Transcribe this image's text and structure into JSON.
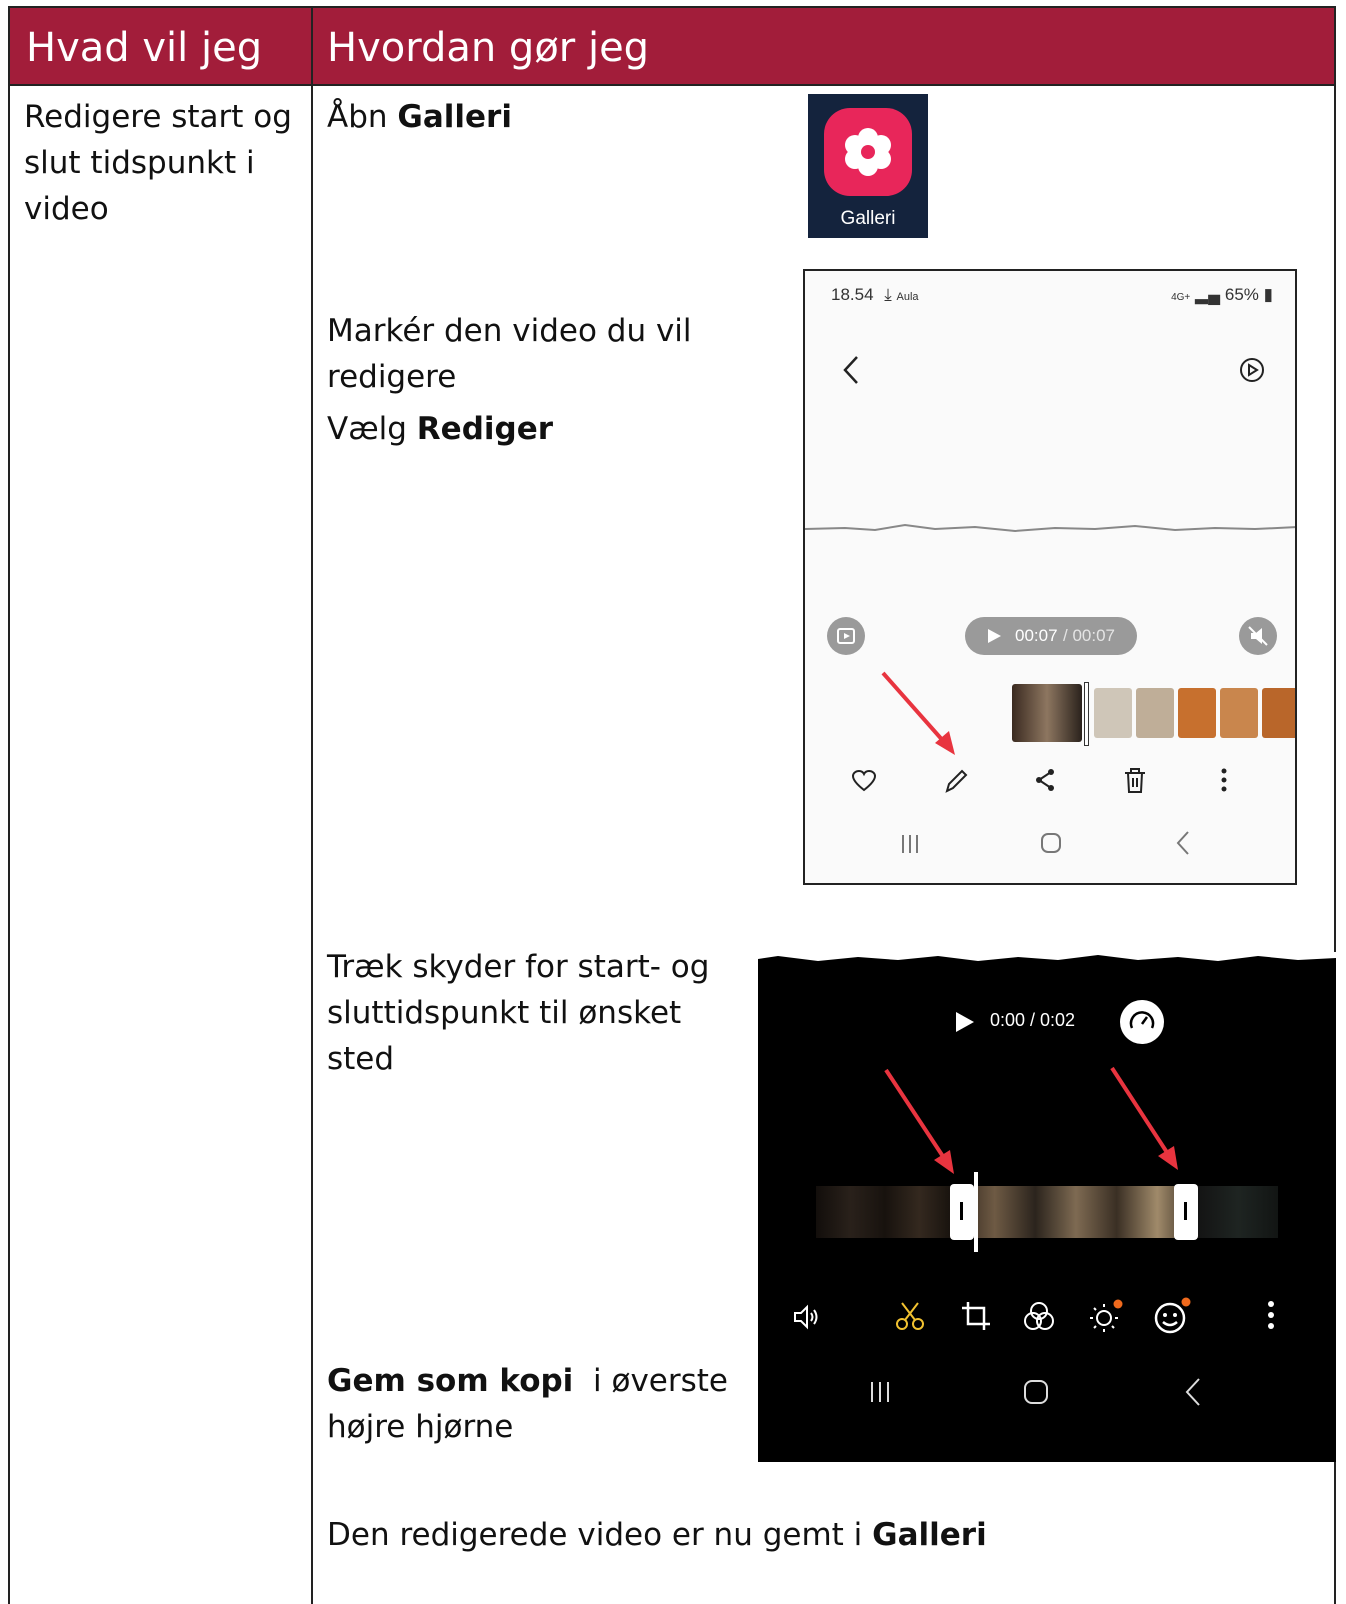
{
  "header": {
    "col1": "Hvad vil jeg",
    "col2": "Hvordan gør jeg"
  },
  "task": {
    "line1": "Redigere start og",
    "line2": "slut tidspunkt i",
    "line3": "video"
  },
  "steps": {
    "s1_prefix": "Åbn ",
    "s1_bold": "Galleri",
    "s2_line1": "Markér den video du vil",
    "s2_line2": "redigere",
    "s3_prefix": "Vælg ",
    "s3_bold": "Rediger",
    "s4_line1": "Træk skyder for start- og",
    "s4_line2": "sluttidspunkt til ønsket",
    "s4_line3": "sted",
    "s5_bold": "Gem som kopi",
    "s5_rest": "  i øverste",
    "s5_line2": "højre hjørne",
    "s6_prefix": "Den redigerede video er nu gemt i ",
    "s6_bold": "Galleri"
  },
  "gallery_icon": {
    "label": "Galleri",
    "colors": {
      "bg": "#14233d",
      "app": "#e8265a"
    }
  },
  "phone1": {
    "status_time": "18.54",
    "status_extra": "Aula",
    "status_right": "65%",
    "network": "4G+",
    "time_current": "00:07",
    "time_sep": " / ",
    "time_total": "00:07",
    "icons": [
      "back-chevron-icon",
      "rotate-video-icon",
      "capture-icon",
      "play-icon",
      "mute-icon",
      "heart-icon",
      "pencil-icon",
      "share-icon",
      "trash-icon",
      "more-icon",
      "recents-icon",
      "home-icon",
      "back-icon"
    ]
  },
  "phone2": {
    "time": "0:00 / 0:02",
    "icons": [
      "play-icon",
      "speed-icon",
      "volume-icon",
      "scissors-icon",
      "crop-icon",
      "filter-icon",
      "brightness-icon",
      "sticker-icon",
      "more-icon",
      "recents-icon",
      "home-icon",
      "back-icon"
    ],
    "colors": {
      "accent": "#f2c230",
      "dot": "#f06a1d",
      "arrow": "#e8343f"
    }
  },
  "colors": {
    "header_bg": "#a21d3a",
    "header_text": "#ffffff"
  }
}
